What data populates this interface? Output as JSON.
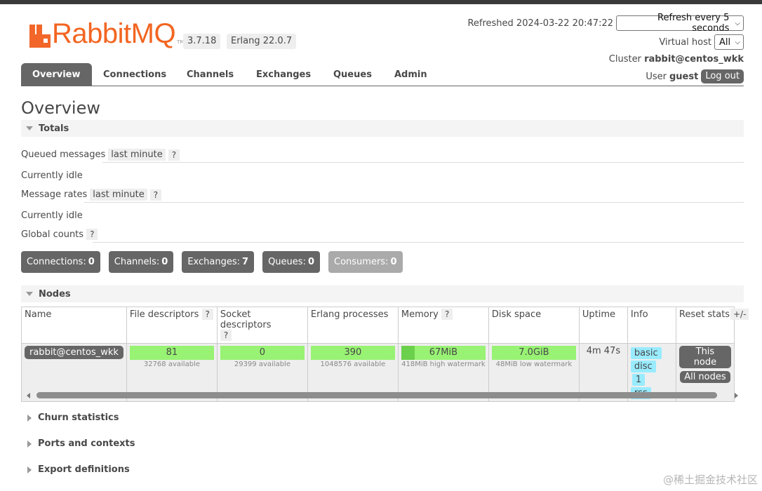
{
  "header": {
    "logo_text": "RabbitMQ",
    "logo_tm": "TM",
    "version": "3.7.18",
    "erlang": "Erlang 22.0.7",
    "refreshed": "Refreshed 2024-03-22 20:47:22",
    "refresh_select": "Refresh every 5 seconds",
    "vhost_label": "Virtual host",
    "vhost_select": "All",
    "cluster_label": "Cluster",
    "cluster_name": "rabbit@centos_wkk",
    "user_label": "User",
    "user_name": "guest",
    "logout": "Log out"
  },
  "nav": {
    "tabs": [
      "Overview",
      "Connections",
      "Channels",
      "Exchanges",
      "Queues",
      "Admin"
    ],
    "active": "Overview"
  },
  "overview": {
    "title": "Overview",
    "totals": {
      "heading": "Totals",
      "queued_label": "Queued messages",
      "queued_range": "last minute",
      "help": "?",
      "queued_status": "Currently idle",
      "rates_label": "Message rates",
      "rates_range": "last minute",
      "rates_status": "Currently idle",
      "global_label": "Global counts"
    },
    "counts": [
      {
        "label": "Connections:",
        "value": "0"
      },
      {
        "label": "Channels:",
        "value": "0"
      },
      {
        "label": "Exchanges:",
        "value": "7"
      },
      {
        "label": "Queues:",
        "value": "0"
      },
      {
        "label": "Consumers:",
        "value": "0"
      }
    ]
  },
  "nodes": {
    "heading": "Nodes",
    "columns": [
      "Name",
      "File descriptors",
      "Socket descriptors",
      "Erlang processes",
      "Memory",
      "Disk space",
      "Uptime",
      "Info",
      "Reset stats"
    ],
    "plus_minus": "+/-",
    "row": {
      "name": "rabbit@centos_wkk",
      "fd": "81",
      "fd_sub": "32768 available",
      "sockets": "0",
      "sockets_sub": "29399 available",
      "procs": "390",
      "procs_sub": "1048576 available",
      "memory": "67MiB",
      "memory_sub": "418MiB high watermark",
      "memory_fill": 0.16,
      "disk": "7.0GiB",
      "disk_sub": "48MiB low watermark",
      "uptime": "4m 47s",
      "info_basic": "basic",
      "info_disc": "disc",
      "info_disc_count": "1",
      "info_rss": "rss",
      "reset_this": "This node",
      "reset_all": "All nodes"
    }
  },
  "collapsed_sections": [
    "Churn statistics",
    "Ports and contexts",
    "Export definitions"
  ],
  "watermark": "@稀土掘金技术社区",
  "colors": {
    "brand": "#f26521",
    "bar_green": "#98f273",
    "tag_blue": "#99ebff",
    "button_grey": "#666666"
  }
}
